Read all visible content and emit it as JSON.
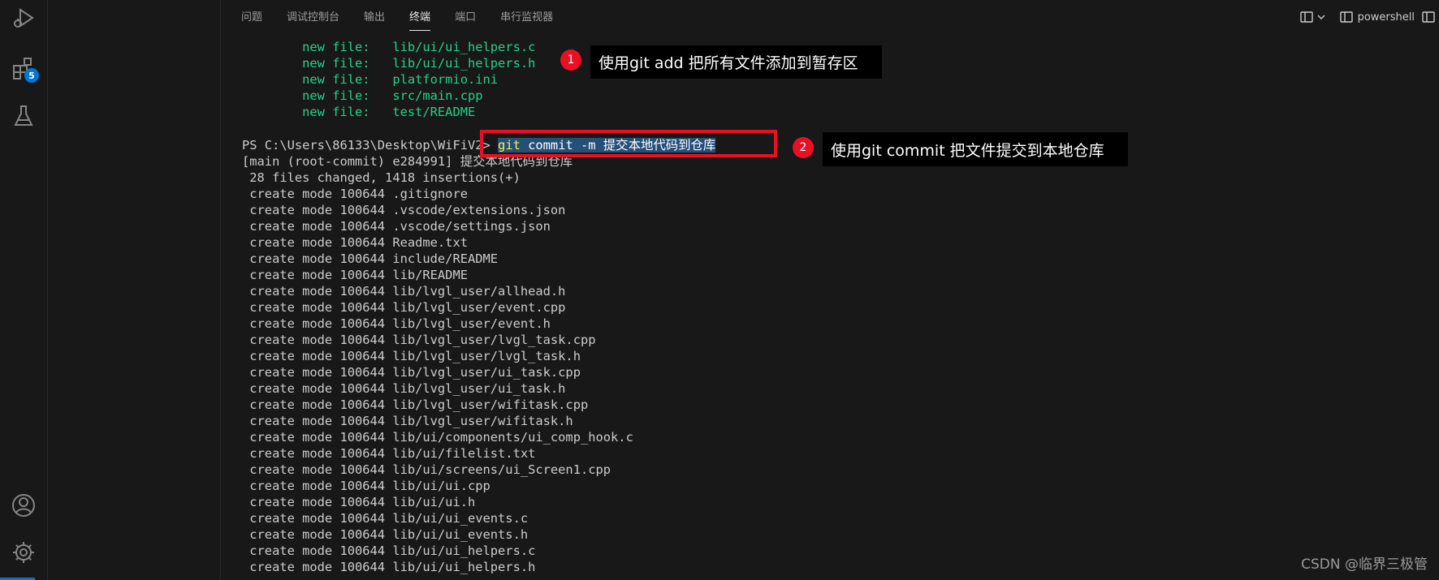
{
  "activity_bar": {
    "extensions_badge": "5",
    "icons": [
      "run-debug-icon",
      "extensions-icon",
      "testing-icon",
      "account-icon",
      "settings-gear-icon"
    ]
  },
  "panel": {
    "tabs": [
      {
        "label": "问题",
        "active": false
      },
      {
        "label": "调试控制台",
        "active": false
      },
      {
        "label": "输出",
        "active": false
      },
      {
        "label": "终端",
        "active": true
      },
      {
        "label": "端口",
        "active": false
      },
      {
        "label": "串行监视器",
        "active": false
      }
    ],
    "shell_name": "powershell"
  },
  "terminal": {
    "new_file_lines": [
      "        new file:   lib/ui/ui_helpers.c",
      "        new file:   lib/ui/ui_helpers.h",
      "        new file:   platformio.ini",
      "        new file:   src/main.cpp",
      "        new file:   test/README"
    ],
    "prompt": "PS C:\\Users\\86133\\Desktop\\WiFiV2> ",
    "command_git": "git",
    "command_rest": " commit -m 提交本地代码到仓库",
    "output_lines": [
      "[main (root-commit) e284991] 提交本地代码到仓库",
      " 28 files changed, 1418 insertions(+)",
      " create mode 100644 .gitignore",
      " create mode 100644 .vscode/extensions.json",
      " create mode 100644 .vscode/settings.json",
      " create mode 100644 Readme.txt",
      " create mode 100644 include/README",
      " create mode 100644 lib/README",
      " create mode 100644 lib/lvgl_user/allhead.h",
      " create mode 100644 lib/lvgl_user/event.cpp",
      " create mode 100644 lib/lvgl_user/event.h",
      " create mode 100644 lib/lvgl_user/lvgl_task.cpp",
      " create mode 100644 lib/lvgl_user/lvgl_task.h",
      " create mode 100644 lib/lvgl_user/ui_task.cpp",
      " create mode 100644 lib/lvgl_user/ui_task.h",
      " create mode 100644 lib/lvgl_user/wifitask.cpp",
      " create mode 100644 lib/lvgl_user/wifitask.h",
      " create mode 100644 lib/ui/components/ui_comp_hook.c",
      " create mode 100644 lib/ui/filelist.txt",
      " create mode 100644 lib/ui/screens/ui_Screen1.cpp",
      " create mode 100644 lib/ui/ui.cpp",
      " create mode 100644 lib/ui/ui.h",
      " create mode 100644 lib/ui/ui_events.c",
      " create mode 100644 lib/ui/ui_events.h",
      " create mode 100644 lib/ui/ui_helpers.c",
      " create mode 100644 lib/ui/ui_helpers.h"
    ]
  },
  "annotations": {
    "step1_number": "1",
    "step1_text": "使用git add 把所有文件添加到暂存区",
    "step2_number": "2",
    "step2_text": "使用git commit 把文件提交到本地仓库"
  },
  "watermark": "CSDN @临界三极管",
  "colors": {
    "background": "#181818",
    "terminal_green": "#23d18b",
    "selection": "#264f78",
    "annotation_red": "#e81123",
    "badge_blue": "#0078d4"
  }
}
